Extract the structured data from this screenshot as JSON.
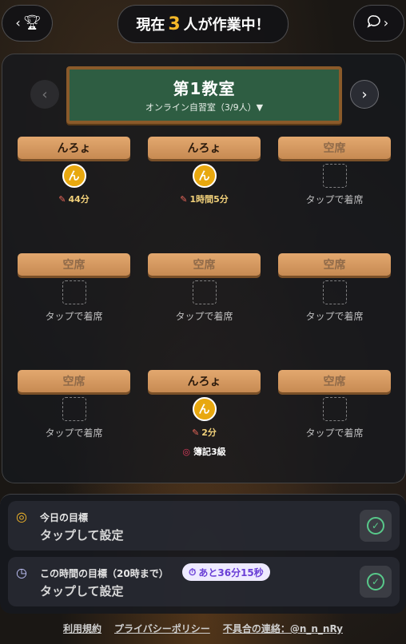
{
  "header": {
    "status_prefix": "現在",
    "status_count": "3",
    "status_suffix": "人が作業中！"
  },
  "room": {
    "title": "第1教室",
    "subtitle": "オンライン自習室（3/9人）▼"
  },
  "seats": [
    {
      "name": "んろょ",
      "avatar": "ん",
      "time": "44分",
      "goal": "",
      "hint": ""
    },
    {
      "name": "んろょ",
      "avatar": "ん",
      "time": "1時間5分",
      "goal": "",
      "hint": ""
    },
    {
      "name": "空席",
      "avatar": "",
      "time": "",
      "goal": "",
      "hint": "タップで着席"
    },
    {
      "name": "空席",
      "avatar": "",
      "time": "",
      "goal": "",
      "hint": "タップで着席"
    },
    {
      "name": "空席",
      "avatar": "",
      "time": "",
      "goal": "",
      "hint": "タップで着席"
    },
    {
      "name": "空席",
      "avatar": "",
      "time": "",
      "goal": "",
      "hint": "タップで着席"
    },
    {
      "name": "空席",
      "avatar": "",
      "time": "",
      "goal": "",
      "hint": "タップで着席"
    },
    {
      "name": "んろょ",
      "avatar": "ん",
      "time": "2分",
      "goal": "簿記3級",
      "hint": ""
    },
    {
      "name": "空席",
      "avatar": "",
      "time": "",
      "goal": "",
      "hint": "タップで着席"
    }
  ],
  "goals": {
    "today": {
      "label": "今日の目標",
      "value": "タップして設定"
    },
    "hour": {
      "label": "この時間の目標（20時まで）",
      "countdown": "あと36分15秒",
      "value": "タップして設定"
    }
  },
  "footer": {
    "terms": "利用規約",
    "privacy": "プライバシーポリシー",
    "contact": "不具合の連絡：@n_n_nRy"
  },
  "colors": {
    "accent": "#f5b829",
    "board": "#2e5d42",
    "check": "#58c98a"
  }
}
